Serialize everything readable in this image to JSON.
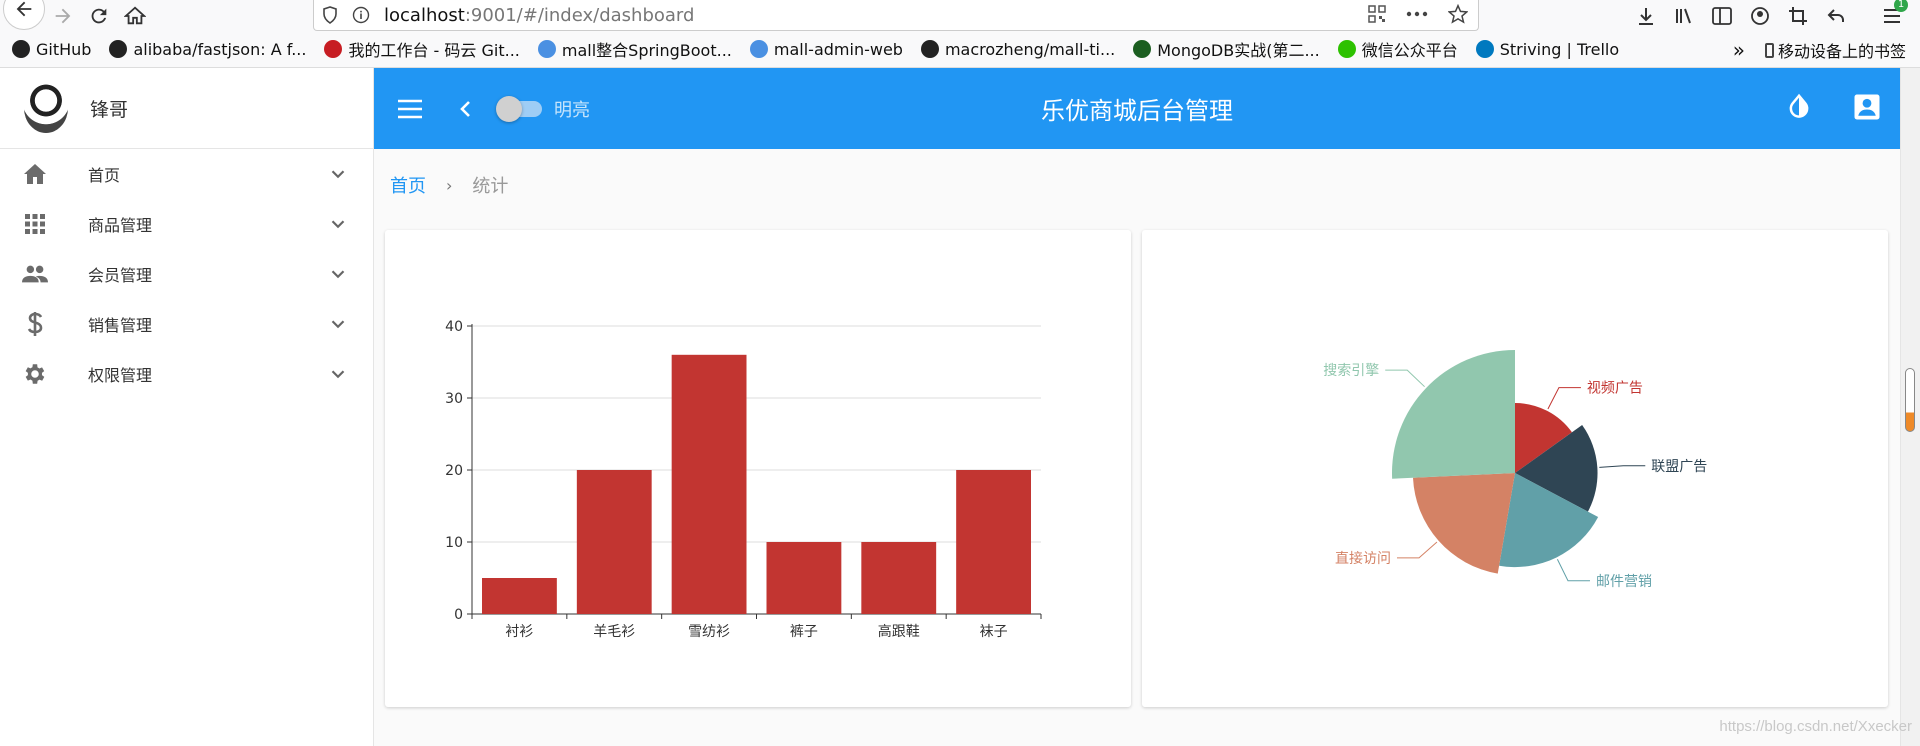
{
  "browser": {
    "url_host": "localhost",
    "url_rest": ":9001/#/index/dashboard",
    "bookmarks": [
      {
        "label": "GitHub",
        "icon": "github-icon"
      },
      {
        "label": "alibaba/fastjson: A f...",
        "icon": "github-icon"
      },
      {
        "label": "我的工作台 - 码云 Git...",
        "icon": "gitee-icon"
      },
      {
        "label": "mall整合SpringBoot...",
        "icon": "shop-icon"
      },
      {
        "label": "mall-admin-web",
        "icon": "shop-icon"
      },
      {
        "label": "macrozheng/mall-ti...",
        "icon": "github-icon"
      },
      {
        "label": "MongoDB实战(第二...",
        "icon": "book-icon"
      },
      {
        "label": "微信公众平台",
        "icon": "wechat-icon"
      },
      {
        "label": "Striving | Trello",
        "icon": "trello-icon"
      }
    ],
    "mobile_bookmarks": "移动设备上的书签",
    "badge": "1"
  },
  "sidebar": {
    "profile_name": "锋哥",
    "items": [
      {
        "label": "首页",
        "icon": "home-icon"
      },
      {
        "label": "商品管理",
        "icon": "apps-icon"
      },
      {
        "label": "会员管理",
        "icon": "people-icon"
      },
      {
        "label": "销售管理",
        "icon": "dollar-icon"
      },
      {
        "label": "权限管理",
        "icon": "gear-icon"
      }
    ]
  },
  "appbar": {
    "toggle_label": "明亮",
    "title": "乐优商城后台管理"
  },
  "breadcrumb": {
    "home": "首页",
    "current": "统计"
  },
  "chart_data": [
    {
      "type": "bar",
      "categories": [
        "衬衫",
        "羊毛衫",
        "雪纺衫",
        "裤子",
        "高跟鞋",
        "袜子"
      ],
      "values": [
        5,
        20,
        36,
        10,
        10,
        20
      ],
      "ylim": [
        0,
        40
      ],
      "yticks": [
        0,
        10,
        20,
        30,
        40
      ],
      "color": "#c23531",
      "grid": true
    },
    {
      "type": "pie",
      "rose": "radius",
      "slices": [
        {
          "name": "视频广告",
          "value": 235,
          "color": "#c23531"
        },
        {
          "name": "联盟广告",
          "value": 274,
          "color": "#2f4554"
        },
        {
          "name": "邮件营销",
          "value": 310,
          "color": "#61a0a8"
        },
        {
          "name": "直接访问",
          "value": 335,
          "color": "#d48265"
        },
        {
          "name": "搜索引擎",
          "value": 400,
          "color": "#91c7ae"
        }
      ]
    }
  ],
  "watermark": "https://blog.csdn.net/Xxecker"
}
